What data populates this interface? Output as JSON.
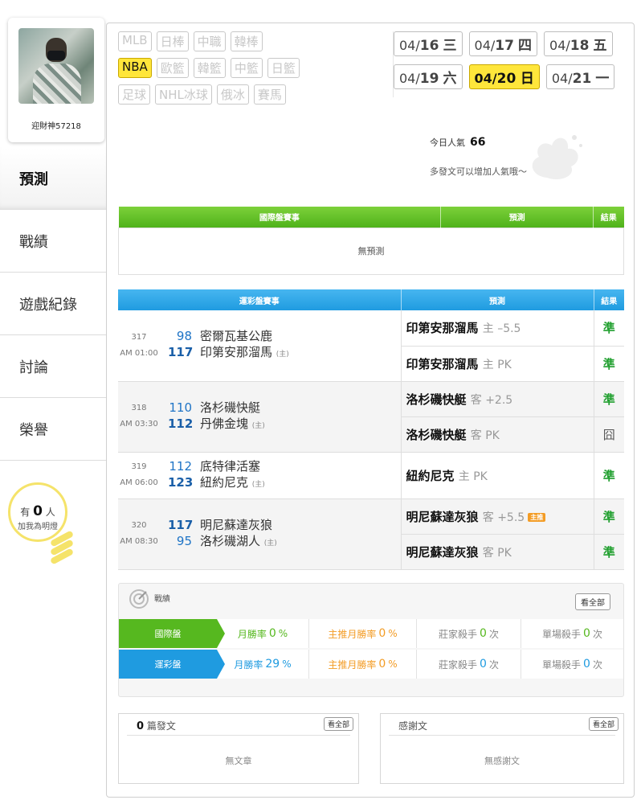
{
  "profile": {
    "username": "迎財神57218"
  },
  "nav": [
    {
      "label": "預測",
      "active": true
    },
    {
      "label": "戰績"
    },
    {
      "label": "遊戲紀錄"
    },
    {
      "label": "討論"
    },
    {
      "label": "榮譽"
    }
  ],
  "bulb": {
    "prefix": "有",
    "count": "0",
    "suffix": "人",
    "line2": "加我為明燈"
  },
  "leagues": [
    [
      "MLB",
      "日棒",
      "中職",
      "韓棒"
    ],
    [
      "NBA",
      "歐籃",
      "韓籃",
      "中籃",
      "日籃"
    ],
    [
      "足球",
      "NHL冰球",
      "俄冰",
      "賽馬"
    ]
  ],
  "active_league": "NBA",
  "dates": [
    [
      {
        "md": "04/",
        "d": "16",
        "w": "三"
      },
      {
        "md": "04/",
        "d": "17",
        "w": "四"
      },
      {
        "md": "04/",
        "d": "18",
        "w": "五"
      }
    ],
    [
      {
        "md": "04/",
        "d": "19",
        "w": "六"
      },
      {
        "md": "04/",
        "d": "20",
        "w": "日",
        "active": true
      },
      {
        "md": "04/",
        "d": "21",
        "w": "一"
      }
    ]
  ],
  "popularity": {
    "label": "今日人氣",
    "value": "66",
    "tip": "多發文可以增加人氣哦～"
  },
  "intl_table": {
    "col1": "國際盤賽事",
    "col2": "預測",
    "col3": "結果",
    "empty": "無預測"
  },
  "lottery_table": {
    "col1": "運彩盤賽事",
    "col2": "預測",
    "col3": "結果",
    "games": [
      {
        "no": "317",
        "time": "AM 01:00",
        "away_score": "98",
        "away": "密爾瓦基公鹿",
        "home_score": "117",
        "home": "印第安那溜馬",
        "home_tag": "(主)",
        "preds": [
          {
            "team": "印第安那溜馬",
            "side": "主 –5.5",
            "result": "準"
          },
          {
            "team": "印第安那溜馬",
            "side": "主 PK",
            "result": "準"
          }
        ]
      },
      {
        "no": "318",
        "time": "AM 03:30",
        "away_score": "110",
        "away": "洛杉磯快艇",
        "home_score": "112",
        "home": "丹佛金塊",
        "home_tag": "(主)",
        "preds": [
          {
            "team": "洛杉磯快艇",
            "side": "客 +2.5",
            "result": "準"
          },
          {
            "team": "洛杉磯快艇",
            "side": "客 PK",
            "result": "囧"
          }
        ]
      },
      {
        "no": "319",
        "time": "AM 06:00",
        "away_score": "112",
        "away": "底特律活塞",
        "home_score": "123",
        "home": "紐約尼克",
        "home_tag": "(主)",
        "preds": [
          {
            "team": "紐約尼克",
            "side": "主 PK",
            "result": "準"
          }
        ]
      },
      {
        "no": "320",
        "time": "AM 08:30",
        "away_score": "117",
        "away": "明尼蘇達灰狼",
        "home_score": "95",
        "home": "洛杉磯湖人",
        "home_tag": "(主)",
        "preds": [
          {
            "team": "明尼蘇達灰狼",
            "side": "客 +5.5",
            "badge": "主推",
            "result": "準"
          },
          {
            "team": "明尼蘇達灰狼",
            "side": "客 PK",
            "result": "準"
          }
        ]
      }
    ]
  },
  "stats": {
    "title": "戰績",
    "view_all": "看全部",
    "rows": [
      {
        "label": "國際盤",
        "monthly_label": "月勝率",
        "monthly": "0",
        "featured_label": "主推月勝率",
        "featured": "0",
        "pct": "%",
        "banker_label": "莊家殺手",
        "banker": "0",
        "single_label": "單場殺手",
        "single": "0",
        "times": "次"
      },
      {
        "label": "運彩盤",
        "monthly_label": "月勝率",
        "monthly": "29",
        "featured_label": "主推月勝率",
        "featured": "0",
        "pct": "%",
        "banker_label": "莊家殺手",
        "banker": "0",
        "single_label": "單場殺手",
        "single": "0",
        "times": "次"
      }
    ]
  },
  "posts": {
    "count": "0",
    "label": "篇發文",
    "view_all": "看全部",
    "empty": "無文章"
  },
  "thanks": {
    "label": "感謝文",
    "view_all": "看全部",
    "empty": "無感謝文"
  }
}
